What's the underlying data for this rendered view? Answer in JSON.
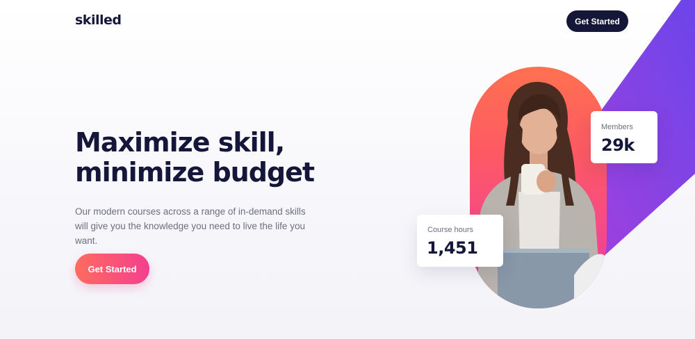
{
  "header": {
    "logo": "skilled",
    "cta_label": "Get Started"
  },
  "hero": {
    "headline_line1": "Maximize skill,",
    "headline_line2": "minimize budget",
    "subcopy": "Our modern courses across a range of in-demand skills will give you the knowledge you need to live the life you want.",
    "cta_label": "Get Started"
  },
  "stats": {
    "members": {
      "label": "Members",
      "value": "29k"
    },
    "course_hours": {
      "label": "Course hours",
      "value": "1,451"
    }
  },
  "colors": {
    "navy": "#141737",
    "gradient_start": "#ff6b5f",
    "gradient_end": "#f43f8e",
    "purple": "#7b3fe8"
  }
}
